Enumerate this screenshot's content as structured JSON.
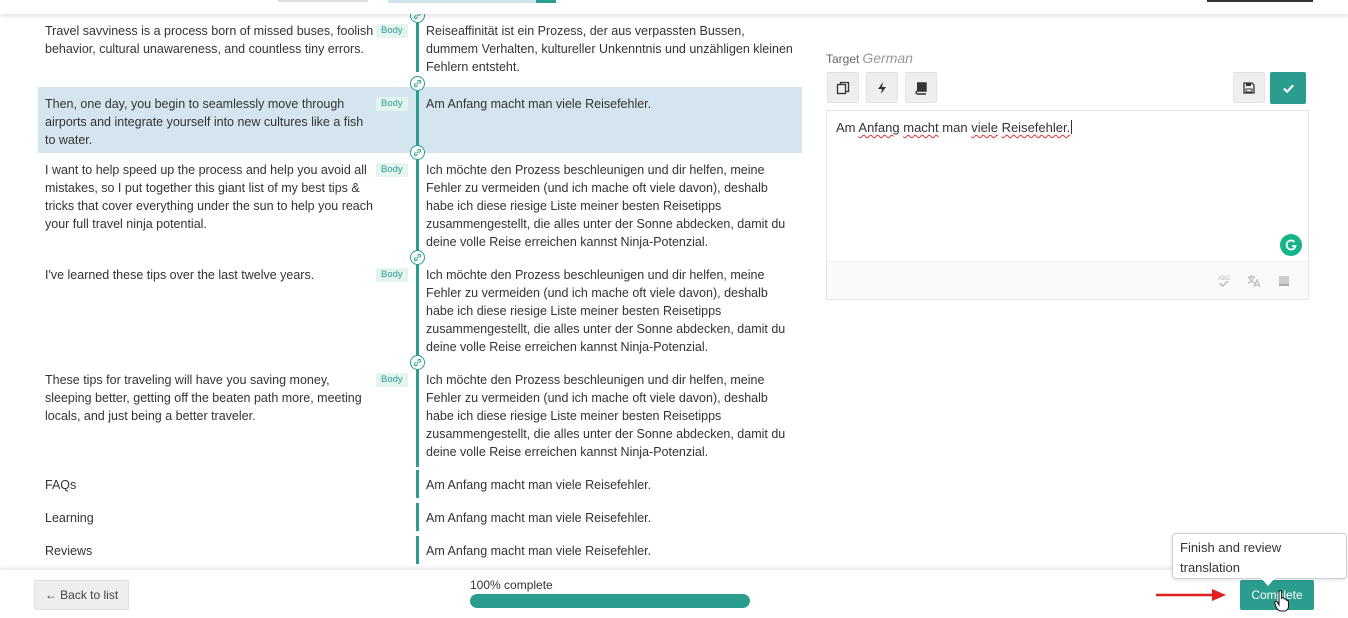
{
  "segments": [
    {
      "source": "Travel savviness is a process born of missed buses, foolish behavior, cultural unawareness, and countless tiny errors.",
      "badge": "Body",
      "target": "Reiseaffinität ist ein Prozess, der aus verpassten Bussen, dummem Verhalten, kultureller Unkenntnis und unzähligen kleinen Fehlern entsteht."
    },
    {
      "source": "Then, one day, you begin to seamlessly move through airports and integrate yourself into new cultures like a fish to water.",
      "badge": "Body",
      "target": "Am Anfang macht man viele Reisefehler.",
      "active": true
    },
    {
      "source": "I want to help speed up the process and help you avoid all mistakes, so I put together this giant list of my best tips & tricks that cover everything under the sun to help you reach your full travel ninja potential.",
      "badge": "Body",
      "target": "Ich möchte den Prozess beschleunigen und dir helfen, meine Fehler zu vermeiden (und ich mache oft viele davon), deshalb habe ich diese riesige Liste meiner besten Reisetipps zusammengestellt, die alles unter der Sonne abdecken, damit du deine volle Reise erreichen kannst Ninja-Potenzial."
    },
    {
      "source": "I've learned these tips over the last twelve years.",
      "badge": "Body",
      "target": "Ich möchte den Prozess beschleunigen und dir helfen, meine Fehler zu vermeiden (und ich mache oft viele davon), deshalb habe ich diese riesige Liste meiner besten Reisetipps zusammengestellt, die alles unter der Sonne abdecken, damit du deine volle Reise erreichen kannst Ninja-Potenzial."
    },
    {
      "source": "These tips for traveling will have you saving money, sleeping better, getting off the beaten path more, meeting locals, and just being a better traveler.",
      "badge": "Body",
      "target": "Ich möchte den Prozess beschleunigen und dir helfen, meine Fehler zu vermeiden (und ich mache oft viele davon), deshalb habe ich diese riesige Liste meiner besten Reisetipps zusammengestellt, die alles unter der Sonne abdecken, damit du deine volle Reise erreichen kannst Ninja-Potenzial."
    },
    {
      "source": "FAQs",
      "badge": "",
      "target": "Am Anfang macht man viele Reisefehler."
    },
    {
      "source": "Learning",
      "badge": "",
      "target": "Am Anfang macht man viele Reisefehler."
    },
    {
      "source": "Reviews",
      "badge": "",
      "target": "Am Anfang macht man viele Reisefehler."
    }
  ],
  "editor": {
    "target_label": "Target",
    "target_language": "German",
    "words": [
      "Am",
      "Anfang",
      "macht",
      "man",
      "viele",
      "Reisefehler."
    ]
  },
  "icons": {
    "copy": "copy-source-icon",
    "lightning": "machine-translate-icon",
    "book": "glossary-icon",
    "save": "save-icon",
    "check": "check-icon",
    "link": "link-icon",
    "grammarly": "grammarly-icon",
    "spellcheck": "spellcheck-icon",
    "translate": "translate-icon",
    "notes": "notes-icon"
  },
  "bottom": {
    "back_label": "← Back to list",
    "progress_label": "100% complete",
    "progress_fraction": 1.0,
    "complete_label": "Complete",
    "tooltip": "Finish and review translation"
  },
  "colors": {
    "accent": "#2a9d8f",
    "active_row": "#d5e5ef",
    "arrow": "#e02020"
  }
}
